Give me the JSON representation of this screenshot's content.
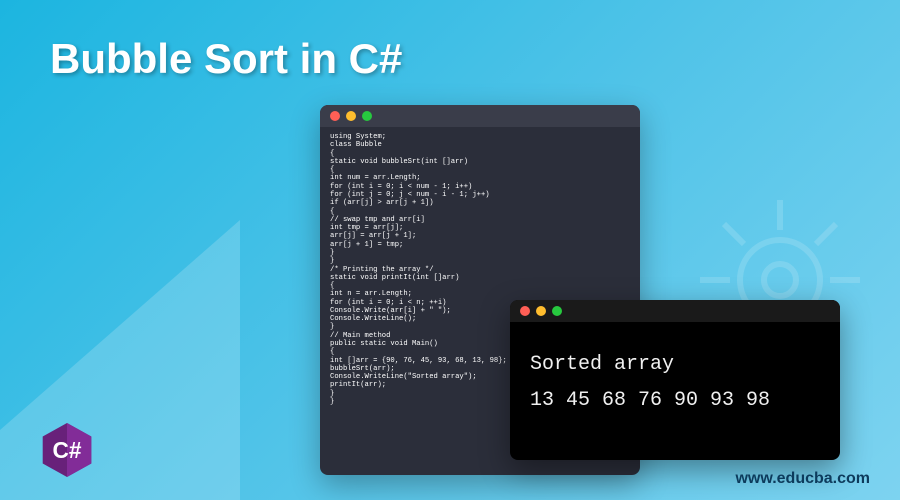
{
  "title": "Bubble Sort in C#",
  "code": {
    "lines": [
      "using System;",
      "class Bubble",
      "{",
      "static void bubbleSrt(int []arr)",
      "{",
      "int num = arr.Length;",
      "for (int i = 0; i < num - 1; i++)",
      "for (int j = 0; j < num - i - 1; j++)",
      "if (arr[j] > arr[j + 1])",
      "{",
      "// swap tmp and arr[i]",
      "int tmp = arr[j];",
      "arr[j] = arr[j + 1];",
      "arr[j + 1] = tmp;",
      "}",
      "}",
      "/* Printing the array */",
      "static void printIt(int []arr)",
      "{",
      "int n = arr.Length;",
      "for (int i = 0; i < n; ++i)",
      "Console.Write(arr[i] + \" \");",
      "Console.WriteLine();",
      "}",
      "// Main method",
      "public static void Main()",
      "{",
      "int []arr = {90, 76, 45, 93, 68, 13, 98};",
      "bubbleSrt(arr);",
      "Console.WriteLine(\"Sorted array\");",
      "printIt(arr);",
      "}",
      "}"
    ]
  },
  "output": {
    "heading": "Sorted array",
    "values": "13  45  68  76  90  93  98"
  },
  "footer": {
    "url": "www.educba.com",
    "logo_label": "C#"
  },
  "colors": {
    "bg_start": "#1cb5e0",
    "bg_end": "#7dd3f0",
    "code_bg": "#2b2e3a",
    "output_bg": "#000000",
    "logo_purple": "#68217a"
  }
}
